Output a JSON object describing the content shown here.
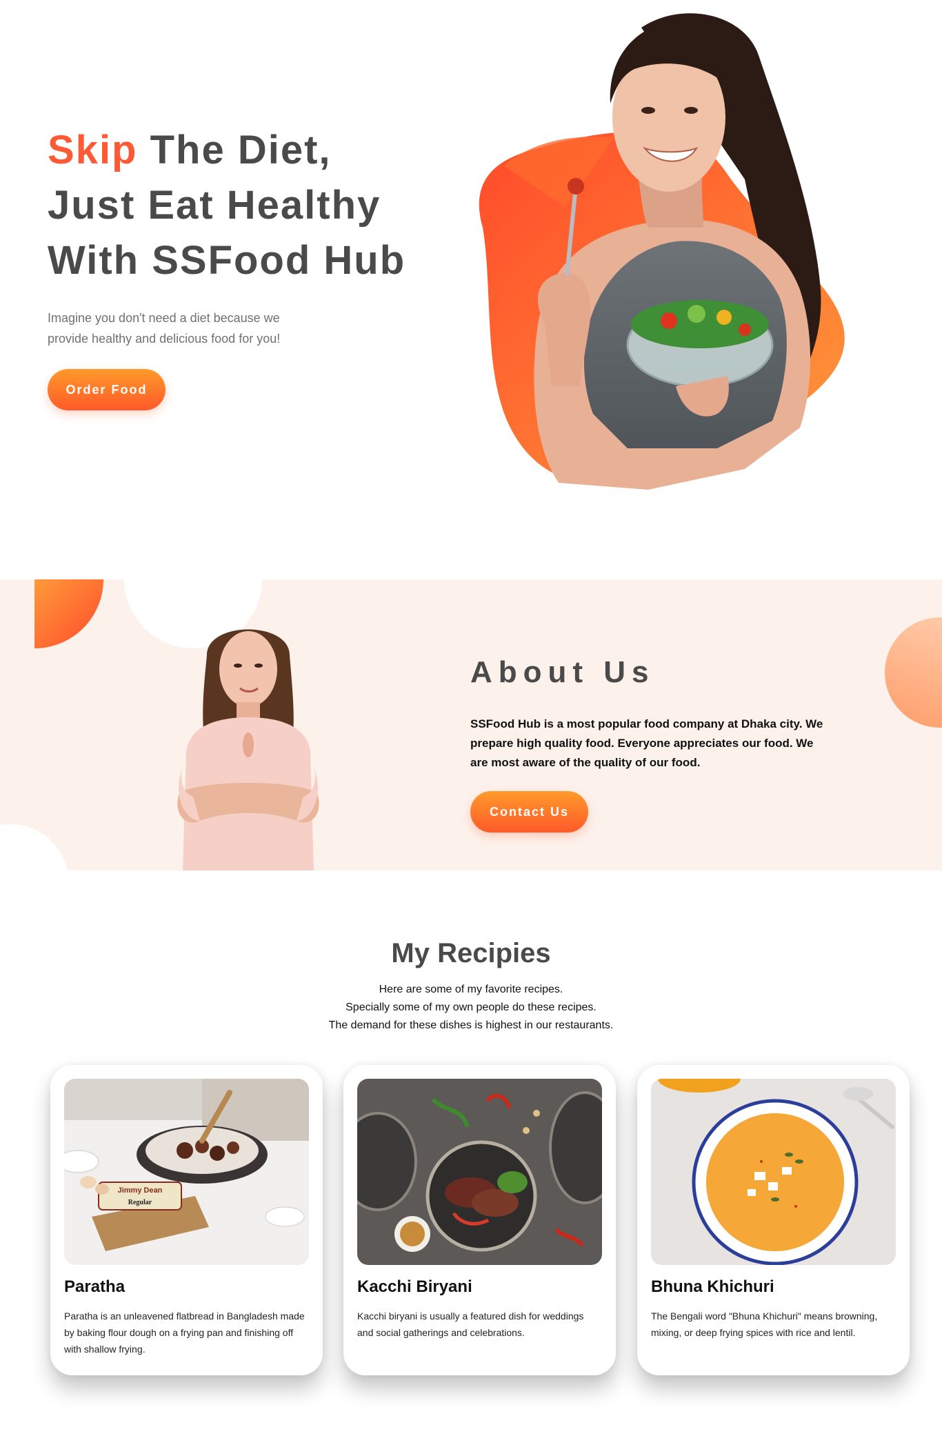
{
  "hero": {
    "title_accent": "Skip",
    "title_line1_rest": " The Diet,",
    "title_line2": "Just Eat Healthy",
    "title_line3": "With SSFood Hub",
    "subtitle": "Imagine you don't need a diet because we provide healthy and delicious food for you!",
    "cta_label": "Order Food"
  },
  "about": {
    "title": "About Us",
    "text": "SSFood Hub is a most popular food company at Dhaka city. We prepare high quality food. Everyone appreciates our food. We are most aware of the quality of our food.",
    "cta_label": "Contact Us"
  },
  "recipes": {
    "title": "My Recipies",
    "intro_lines": [
      "Here are some of my favorite recipes.",
      "Specially some of my own people do these recipes.",
      "The demand for these dishes is highest in our restaurants."
    ],
    "cards": [
      {
        "title": "Paratha",
        "text": "Paratha is an unleavened flatbread in Bangladesh made by baking flour dough on a frying pan and finishing off with shallow frying.",
        "package_label_top": "Jimmy Dean",
        "package_label_bottom": "Regular"
      },
      {
        "title": "Kacchi Biryani",
        "text": "Kacchi biryani is usually a featured dish for weddings and social gatherings and celebrations."
      },
      {
        "title": "Bhuna Khichuri",
        "text": "The Bengali word \"Bhuna Khichuri\" means browning, mixing, or deep frying spices with rice and lentil."
      }
    ]
  },
  "colors": {
    "accent": "#ff5a36",
    "button_gradient_top": "#ff9a2a",
    "button_gradient_bottom": "#ff5a2a",
    "about_background": "#fdf1ec",
    "heading_gray": "#4a4a4a"
  }
}
